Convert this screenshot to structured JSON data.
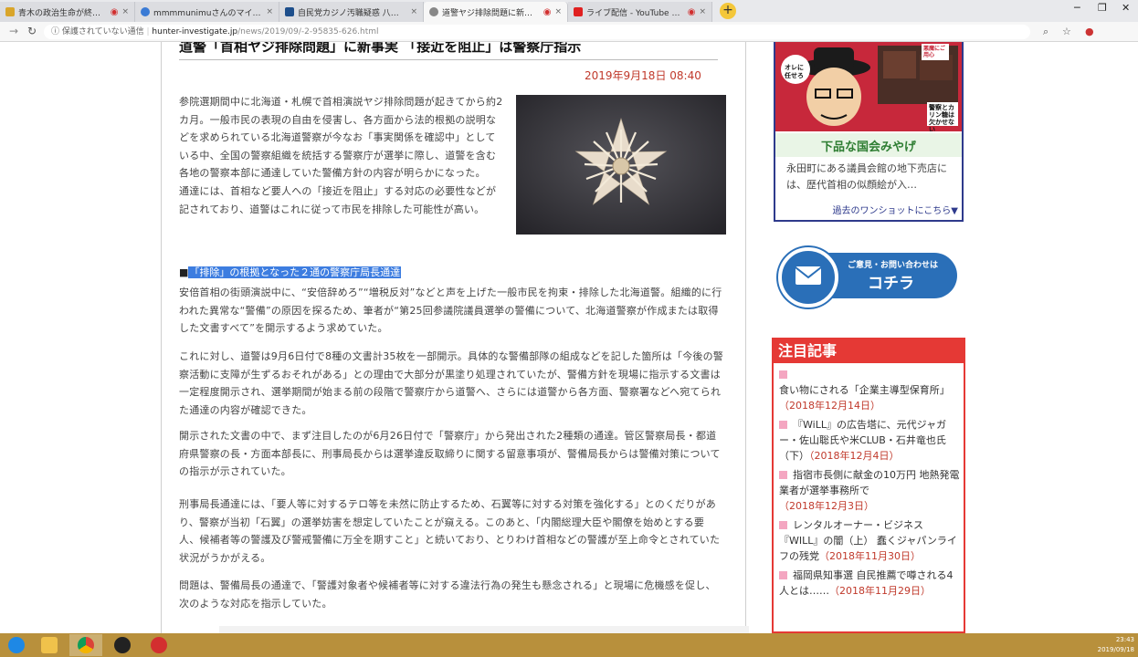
{
  "browser": {
    "tabs": [
      {
        "label": "青木の政治生命が終了？後援会長逮捕",
        "favicon_color": "#d9a52a",
        "audio": true,
        "active": false
      },
      {
        "label": "mmmmunimuさんのマイ投稿",
        "favicon_color": "#3a7bd5",
        "audio": false,
        "active": false
      },
      {
        "label": "自民党カジノ汚職疑惑 八代市長",
        "favicon_color": "#1e4f8c",
        "audio": false,
        "active": false
      },
      {
        "label": "道警ヤジ排除問題に新事実",
        "favicon_color": "#888888",
        "audio": true,
        "active": true
      },
      {
        "label": "ライブ配信 - YouTube Studio",
        "favicon_color": "#e02020",
        "audio": true,
        "active": false
      }
    ],
    "new_tab_label": "+",
    "address": {
      "security_label": "保護されていない通信",
      "host": "hunter-investigate.jp",
      "path": "/news/2019/09/-2-95835-626.html"
    }
  },
  "article": {
    "headline": "道警「首相ヤジ排除問題」に新事実 「接近を阻止」は警察庁指示",
    "date": "2019年9月18日 08:40",
    "para1": "参院選期間中に北海道・札幌で首相演説ヤジ排除問題が起きてから約2カ月。一般市民の表現の自由を侵害し、各方面から法的根拠の説明などを求められている北海道警察が今なお「事実関係を確認中」としている中、全国の警察組織を統括する警察庁が選挙に際し、道警を含む各地の警察本部に通達していた警備方針の内容が明らかになった。",
    "para1b": "通達には、首相など要人への「接近を阻止」する対応の必要性などが記されており、道警はこれに従って市民を排除した可能性が高い。",
    "subhead_marker": "■",
    "subhead": "「排除」の根拠となった２通の警察庁局長通達",
    "para2": "安倍首相の街頭演説中に、“安倍辞めろ”“増税反対”などと声を上げた一般市民を拘束・排除した北海道警。組織的に行われた異常な“警備”の原因を探るため、筆者が“第25回参議院議員選挙の警備について、北海道警察が作成または取得した文書すべて”を開示するよう求めていた。",
    "para3": "これに対し、道警は9月6日付で8種の文書計35枚を一部開示。具体的な警備部隊の組成などを記した箇所は「今後の警察活動に支障が生ずるおそれがある」との理由で大部分が黒塗り処理されていたが、警備方針を現場に指示する文書は一定程度開示され、選挙期間が始まる前の段階で警察庁から道警へ、さらには道警から各方面、警察署などへ宛てられた通達の内容が確認できた。",
    "para4": "開示された文書の中で、まず注目したのが6月26日付で「警察庁」から発出された2種類の通達。管区警察局長・都道府県警察の長・方面本部長に、刑事局長からは選挙違反取締りに関する留意事項が、警備局長からは警備対策についての指示が示されていた。",
    "para5": "刑事局長通達には、「要人等に対するテロ等を未然に防止するため、石翼等に対する対策を強化する」とのくだりがあり、警察が当初「石翼」の選挙妨害を想定していたことが窺える。このあと、「内閣総理大臣や閣僚を始めとする要人、候補者等の警護及び警戒警備に万全を期すこと」と続いており、とりわけ首相などの警護が至上命令とされていた状況がうかがえる。",
    "para6": "問題は、警備局長の通達で、「警護対象者や候補者等に対する違法行為の発生も懸念される」と現場に危機感を促し、次のような対応を指示していた。"
  },
  "sidebar": {
    "ad_caption": "下品な国会みやげ",
    "ad_desc": "永田町にある議員会館の地下売店には、歴代首相の似顔絵が入…",
    "ad_more": "過去のワンショットにこちら▼",
    "ad_bubble": "オレに任せろ",
    "ad_corner": "悪魔にご用心",
    "ad_slogan": "警察とカリン糖は欠かせない",
    "contact_small": "ご意見・お問い合わせは",
    "contact_big": "コチラ",
    "featured_title": "注目記事",
    "featured_items": [
      {
        "title": "食い物にされる「企業主導型保育所」",
        "date": "（2018年12月14日）"
      },
      {
        "title": "『WiLL』の広告塔に、元代ジャガー・佐山聡氏や米CLUB・石井竜也氏（下）",
        "date": "（2018年12月4日）"
      },
      {
        "title": "指宿市長側に献金の10万円 地熱発電業者が選挙事務所で",
        "date": "（2018年12月3日）"
      },
      {
        "title": "レンタルオーナー・ビジネス『WILL』の闇（上） 蠢くジャパンライフの残党",
        "date": "（2018年11月30日）"
      },
      {
        "title": "福岡県知事選 自民推薦で噂される4人とは……",
        "date": "（2018年11月29日）"
      }
    ]
  },
  "taskbar": {
    "clock_time": "23:43",
    "clock_date": "2019/09/18"
  }
}
